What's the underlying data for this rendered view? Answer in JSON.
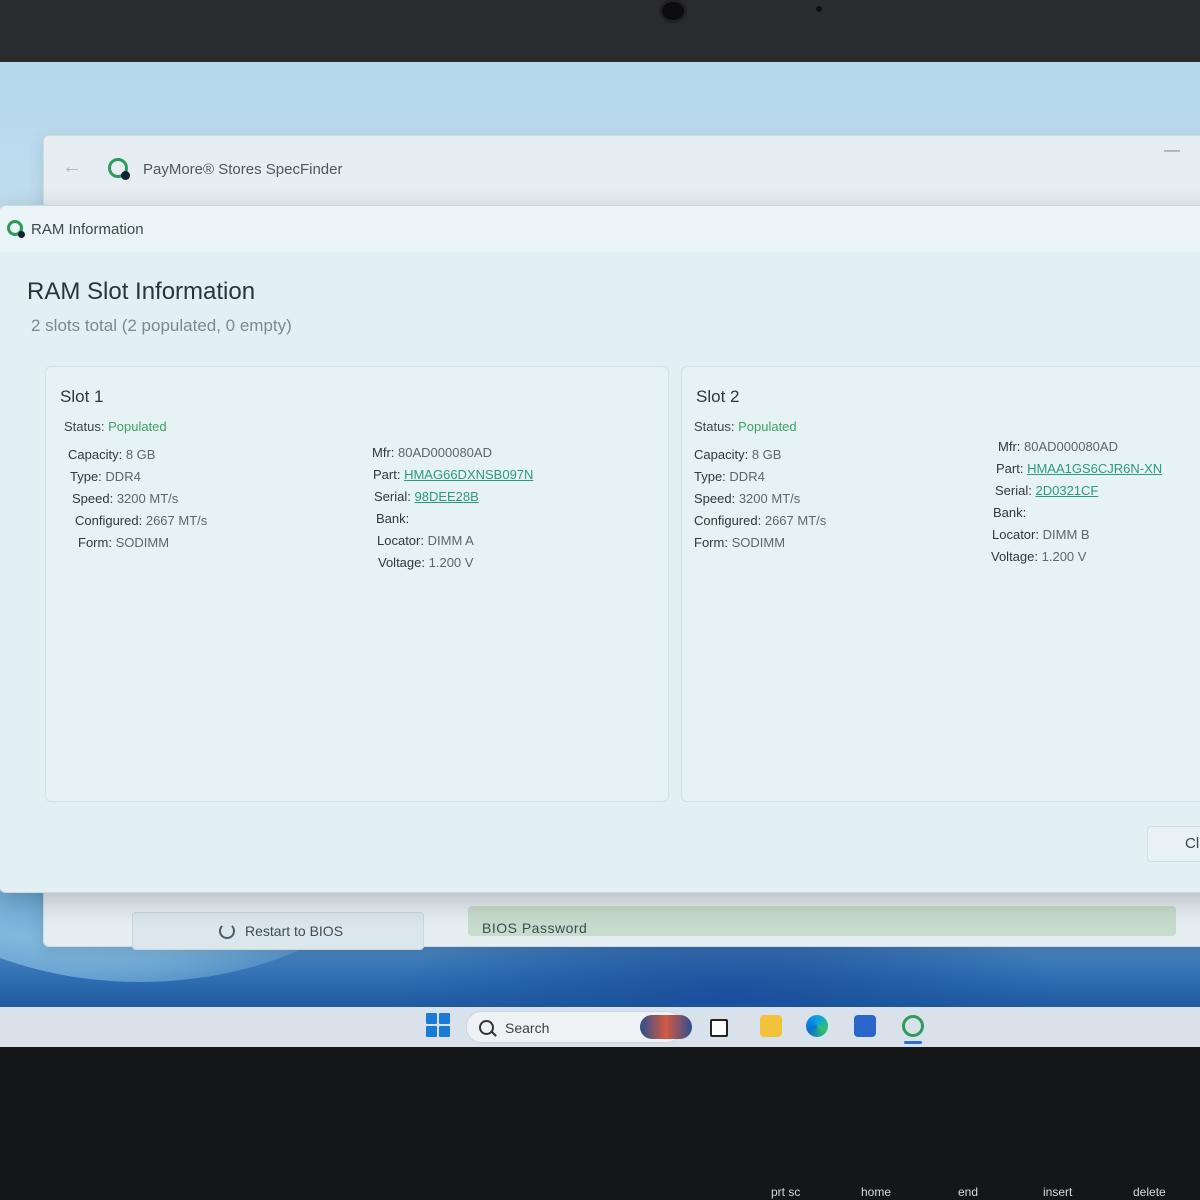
{
  "app": {
    "title": "PayMore® Stores SpecFinder",
    "back_icon": "back-arrow-icon",
    "minimize_glyph": "—"
  },
  "background_buttons": {
    "restart_label": "Restart to BIOS",
    "bios_password_label": "BIOS Password"
  },
  "dialog": {
    "window_title": "RAM Information",
    "heading": "RAM Slot Information",
    "subheading": "2 slots total (2 populated, 0 empty)",
    "close_label": "Cl",
    "slots": [
      {
        "title": "Slot 1",
        "status_label": "Status:",
        "status": "Populated",
        "left": [
          {
            "k": "Capacity:",
            "v": "8 GB"
          },
          {
            "k": "Type:",
            "v": "DDR4"
          },
          {
            "k": "Speed:",
            "v": "3200 MT/s"
          },
          {
            "k": "Configured:",
            "v": "2667 MT/s"
          },
          {
            "k": "Form:",
            "v": "SODIMM"
          }
        ],
        "right": [
          {
            "k": "Mfr:",
            "v": "80AD000080AD"
          },
          {
            "k": "Part:",
            "v": "HMAG66DXNSB097N"
          },
          {
            "k": "Serial:",
            "v": "98DEE28B"
          },
          {
            "k": "Bank:",
            "v": ""
          },
          {
            "k": "Locator:",
            "v": "DIMM A"
          },
          {
            "k": "Voltage:",
            "v": "1.200 V"
          }
        ]
      },
      {
        "title": "Slot 2",
        "status_label": "Status:",
        "status": "Populated",
        "left": [
          {
            "k": "Capacity:",
            "v": "8 GB"
          },
          {
            "k": "Type:",
            "v": "DDR4"
          },
          {
            "k": "Speed:",
            "v": "3200 MT/s"
          },
          {
            "k": "Configured:",
            "v": "2667 MT/s"
          },
          {
            "k": "Form:",
            "v": "SODIMM"
          }
        ],
        "right": [
          {
            "k": "Mfr:",
            "v": "80AD000080AD"
          },
          {
            "k": "Part:",
            "v": "HMAA1GS6CJR6N-XN"
          },
          {
            "k": "Serial:",
            "v": "2D0321CF"
          },
          {
            "k": "Bank:",
            "v": ""
          },
          {
            "k": "Locator:",
            "v": "DIMM B"
          },
          {
            "k": "Voltage:",
            "v": "1.200 V"
          }
        ]
      }
    ]
  },
  "taskbar": {
    "search_label": "Search",
    "icons": [
      "windows-start-icon",
      "search-icon",
      "task-view-icon",
      "file-explorer-icon",
      "edge-icon",
      "store-icon",
      "specfinder-icon"
    ]
  },
  "keyboard": {
    "keys": [
      "prt sc",
      "home",
      "end",
      "insert",
      "delete"
    ]
  },
  "colors": {
    "populated": "#3fa268",
    "link": "#2b9b7d",
    "brand_green": "#2e9a5c"
  }
}
